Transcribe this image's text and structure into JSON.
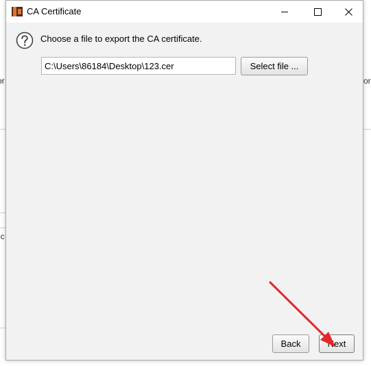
{
  "window": {
    "title": "CA Certificate",
    "controls": {
      "minimize": "minimize-icon",
      "maximize": "maximize-icon",
      "close": "close-icon"
    }
  },
  "content": {
    "prompt": "Choose a file to export the CA certificate.",
    "file_path_value": "C:\\Users\\86184\\Desktop\\123.cer",
    "select_file_label": "Select file ..."
  },
  "footer": {
    "back_label": "Back",
    "next_label": "Next"
  },
  "background": {
    "fragment_1": "or",
    "fragment_2": "or",
    "fragment_3": "ic"
  },
  "colors": {
    "annotation_arrow": "#e8262a",
    "app_icon_orange": "#e8702a",
    "app_icon_dark": "#4a2b1c"
  }
}
